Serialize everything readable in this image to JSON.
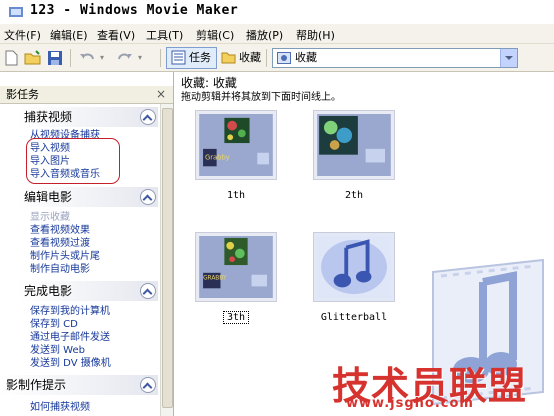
{
  "window": {
    "title": "123 - Windows Movie Maker"
  },
  "menu": [
    "文件(F)",
    "编辑(E)",
    "查看(V)",
    "工具(T)",
    "剪辑(C)",
    "播放(P)",
    "帮助(H)"
  ],
  "toolbar": {
    "tasks_label": "任务",
    "collections_label": "收藏",
    "combo_value": "收藏"
  },
  "taskpane": {
    "header": "影任务",
    "close": "×",
    "groups": [
      {
        "title": "捕获视频",
        "tasks": [
          "从视频设备捕获",
          "导入视频",
          "导入图片",
          "导入音频或音乐"
        ]
      },
      {
        "title": "编辑电影",
        "tasks": [
          "显示收藏",
          "查看视频效果",
          "查看视频过渡",
          "制作片头或片尾",
          "制作自动电影"
        ]
      },
      {
        "title": "完成电影",
        "tasks": [
          "保存到我的计算机",
          "保存到 CD",
          "通过电子邮件发送",
          "发送到 Web",
          "发送到 DV 摄像机"
        ]
      },
      {
        "title": "影制作提示",
        "tasks": [
          "如何捕获视频"
        ]
      }
    ]
  },
  "content": {
    "title": "收藏: 收藏",
    "subtitle": "拖动剪辑并将其放到下面时间线上。",
    "clips": [
      {
        "label": "1th",
        "thumb_text": "Grabby"
      },
      {
        "label": "2th",
        "thumb_text": ""
      },
      {
        "label": "3th",
        "thumb_text": "GRABBY"
      },
      {
        "label": "Glitterball",
        "thumb_text": ""
      }
    ]
  },
  "watermark": {
    "text": "技术员联盟",
    "url": "www.jsgho.com"
  }
}
